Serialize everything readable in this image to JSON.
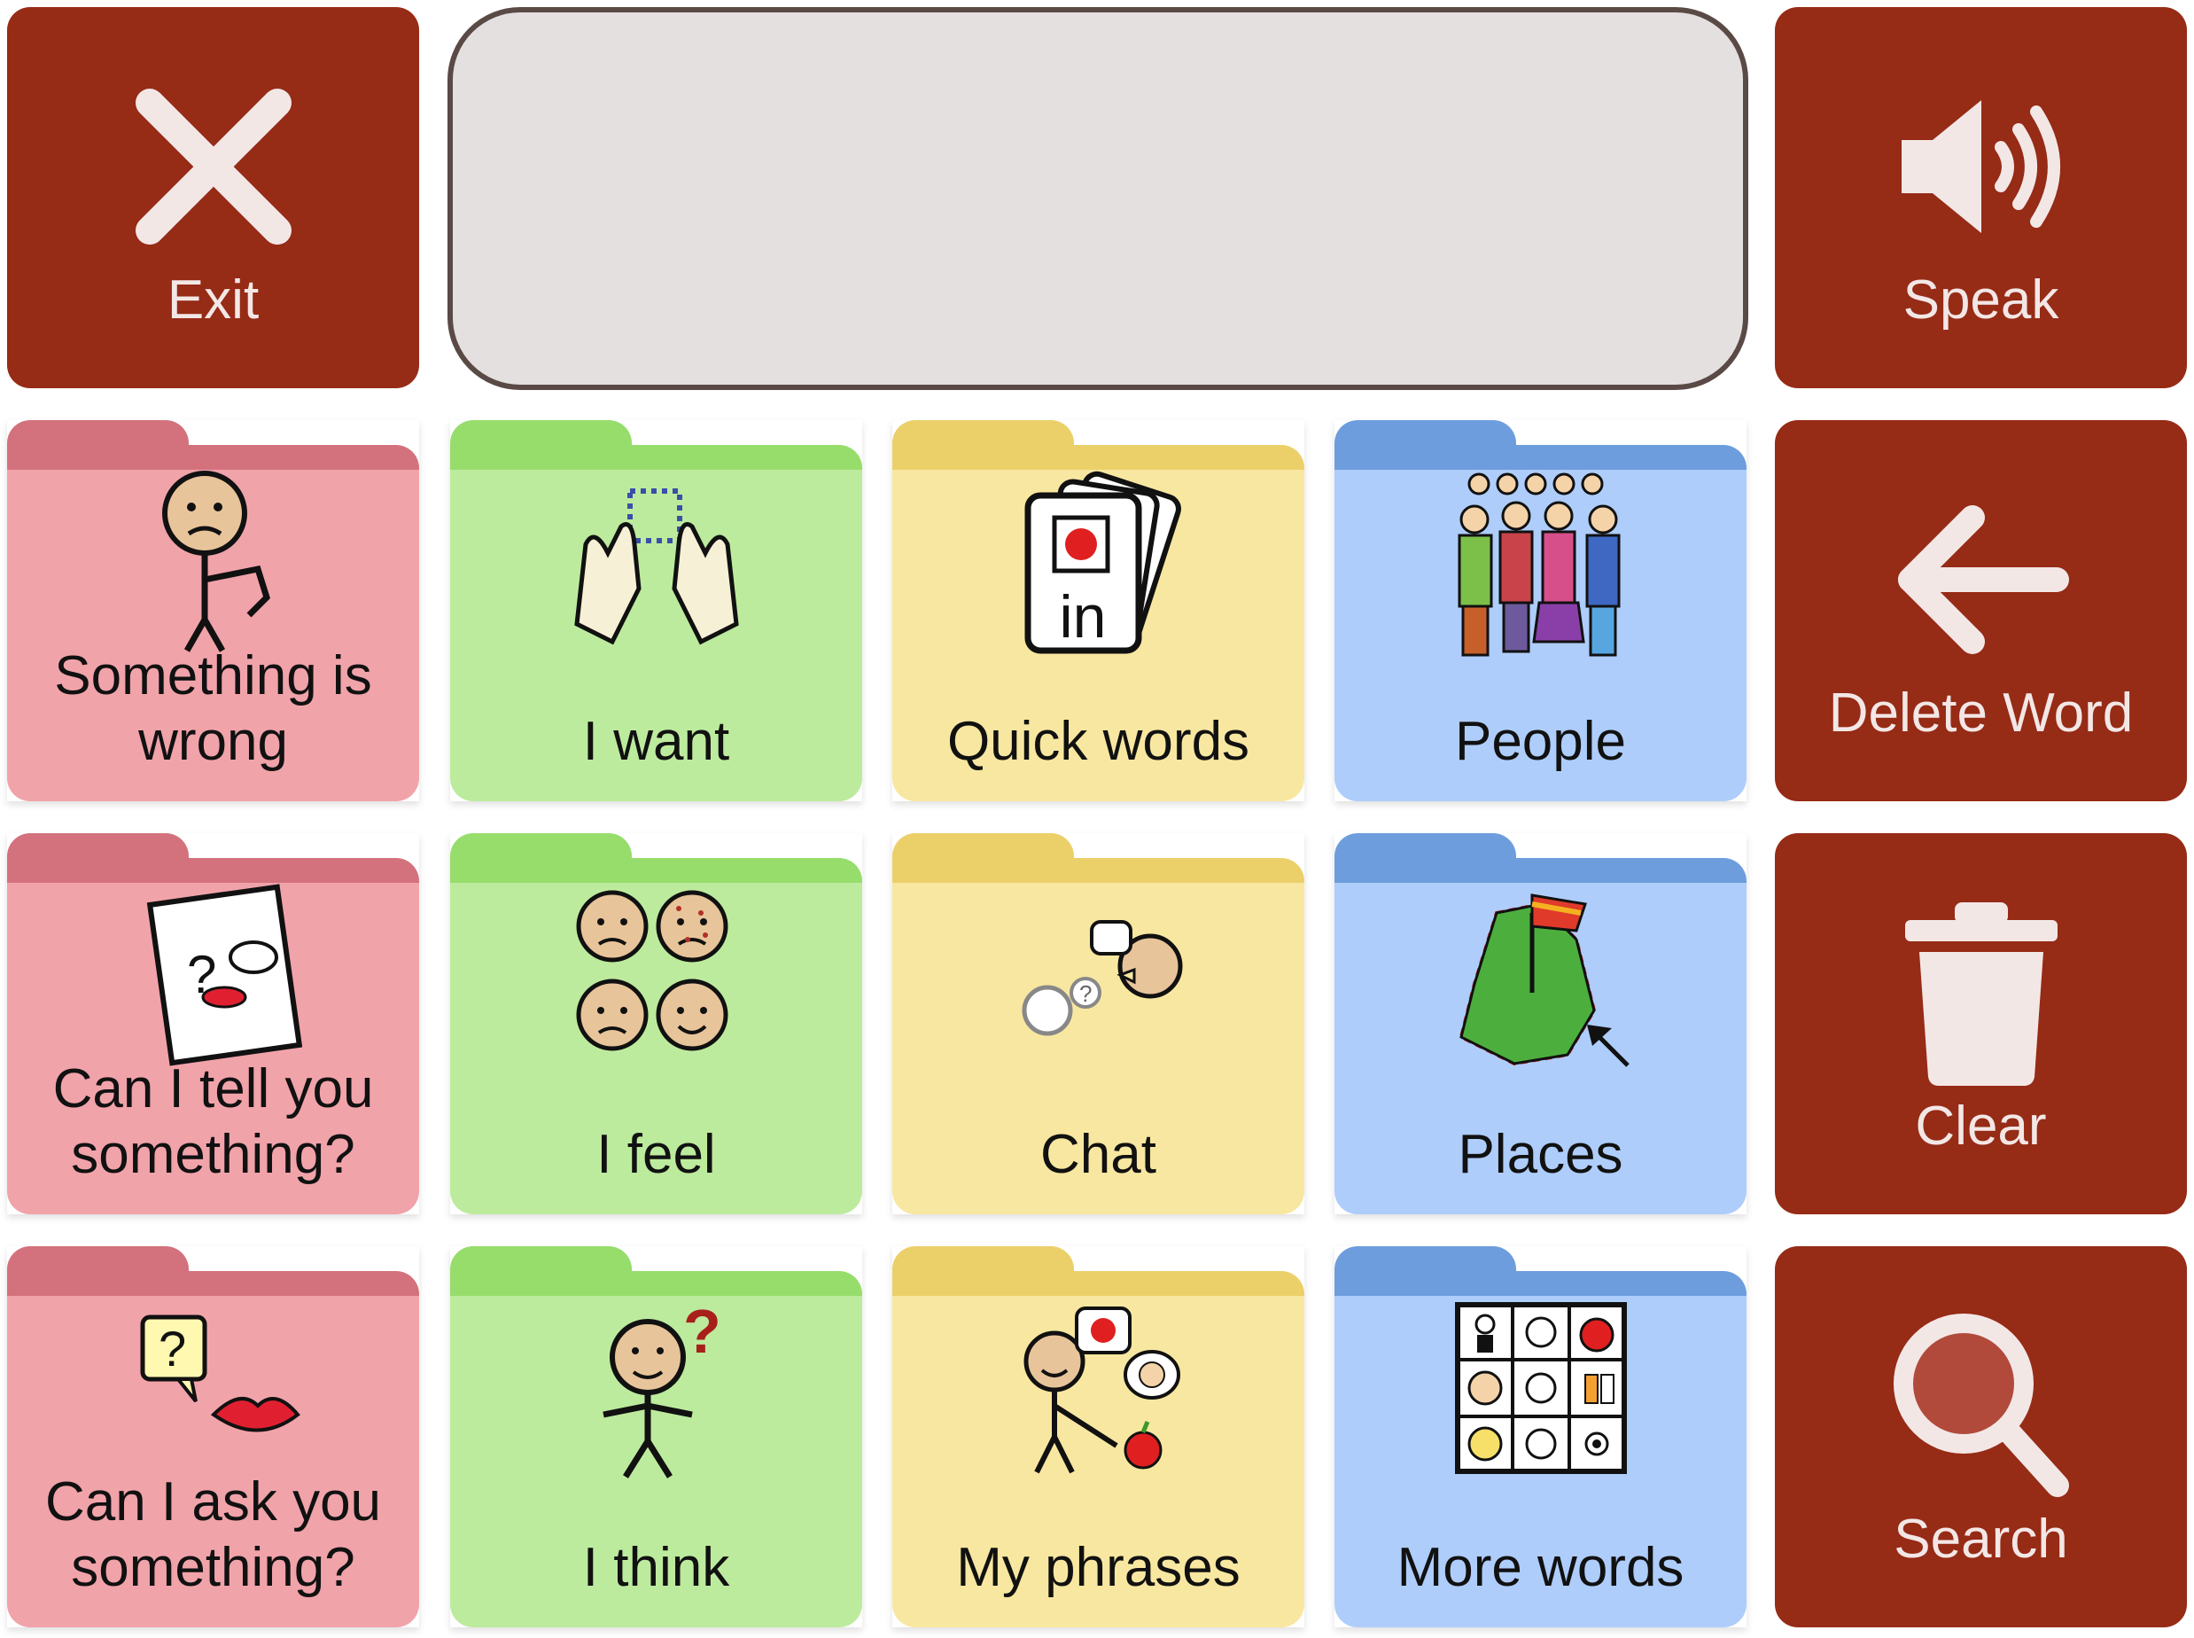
{
  "top_bar": {
    "exit_label": "Exit",
    "speak_label": "Speak",
    "message_text": ""
  },
  "side_buttons": {
    "delete_label": "Delete Word",
    "clear_label": "Clear",
    "search_label": "Search"
  },
  "folders": [
    {
      "label": "Something is wrong",
      "color": "pink",
      "icon": "stop-face-icon"
    },
    {
      "label": "I want",
      "color": "green",
      "icon": "want-hands-icon"
    },
    {
      "label": "Quick words",
      "color": "yellow",
      "icon": "cards-icon"
    },
    {
      "label": "People",
      "color": "blue",
      "icon": "people-group-icon"
    },
    {
      "label": "Can I tell you something?",
      "color": "pink",
      "icon": "tell-card-icon"
    },
    {
      "label": "I feel",
      "color": "green",
      "icon": "feelings-faces-icon"
    },
    {
      "label": "Chat",
      "color": "yellow",
      "icon": "chat-faces-icon"
    },
    {
      "label": "Places",
      "color": "blue",
      "icon": "map-flag-icon"
    },
    {
      "label": "Can I ask you something?",
      "color": "pink",
      "icon": "ask-question-icon"
    },
    {
      "label": "I think",
      "color": "green",
      "icon": "think-person-icon"
    },
    {
      "label": "My phrases",
      "color": "yellow",
      "icon": "phrases-person-icon"
    },
    {
      "label": "More words",
      "color": "blue",
      "icon": "symbol-grid-icon"
    }
  ],
  "colors": {
    "command_bg": "#962b16",
    "command_fg": "#f3e7e6",
    "pink_body": "#f1a3aa",
    "green_body": "#bdeb9e",
    "yellow_body": "#f8e7a0",
    "blue_body": "#aecdfa"
  }
}
